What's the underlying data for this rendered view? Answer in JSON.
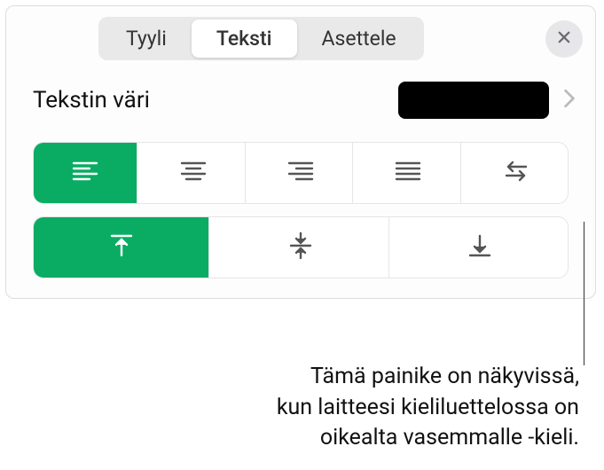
{
  "tabs": {
    "style": "Tyyli",
    "text": "Teksti",
    "layout": "Asettele"
  },
  "color_section": {
    "label": "Tekstin väri",
    "swatch_hex": "#000000"
  },
  "callout": {
    "line1": "Tämä painike on näkyvissä,",
    "line2": "kun laitteesi kieliluettelossa on",
    "line3": "oikealta vasemmalle -kieli."
  }
}
